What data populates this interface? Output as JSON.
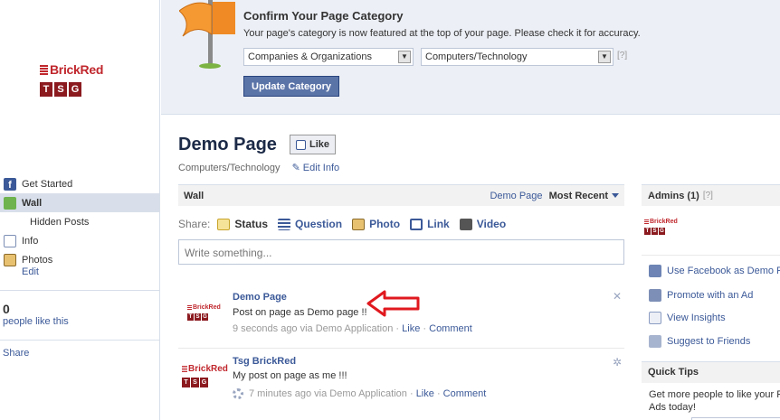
{
  "left": {
    "logo_text": "BrickRed",
    "logo_letters": [
      "T",
      "S",
      "G"
    ],
    "nav": [
      {
        "label": "Get Started",
        "icon": "facebook-icon"
      },
      {
        "label": "Wall",
        "icon": "wall-icon",
        "active": true
      },
      {
        "label": "Hidden Posts",
        "sub": true
      },
      {
        "label": "Info",
        "icon": "info-icon"
      },
      {
        "label": "Photos",
        "icon": "photos-icon"
      }
    ],
    "photos_edit": "Edit",
    "likes_count": "0",
    "likes_label": "people like this",
    "share": "Share"
  },
  "banner": {
    "title": "Confirm Your Page Category",
    "description": "Your page's category is now featured at the top of your page. Please check it for accuracy.",
    "category_select": "Companies & Organizations",
    "subcategory_select": "Computers/Technology",
    "help": "[?]",
    "update_button": "Update Category"
  },
  "page": {
    "title": "Demo Page",
    "like_button": "Like",
    "category": "Computers/Technology",
    "edit_info": "Edit Info"
  },
  "wall": {
    "label": "Wall",
    "filter_page": "Demo Page",
    "filter_sort": "Most Recent",
    "share_label": "Share:",
    "share_items": [
      "Status",
      "Question",
      "Photo",
      "Link",
      "Video"
    ],
    "composer_placeholder": "Write something...",
    "stories": [
      {
        "author": "Demo Page",
        "message": "Post on page as Demo page !!",
        "time": "9 seconds ago via Demo Application",
        "sep": "·",
        "like": "Like",
        "comment": "Comment",
        "close": "✕"
      },
      {
        "author": "Tsg BrickRed",
        "message": "My post on page as me !!!",
        "time": "7 minutes ago via Demo Application",
        "sep": "·",
        "like": "Like",
        "comment": "Comment"
      }
    ]
  },
  "right": {
    "admins_title": "Admins (1)",
    "admins_help": "[?]",
    "links": [
      {
        "label": "Use Facebook as Demo Pa",
        "icon": "facebook-icon"
      },
      {
        "label": "Promote with an Ad",
        "icon": "ad-icon"
      },
      {
        "label": "View Insights",
        "icon": "insights-icon"
      },
      {
        "label": "Suggest to Friends",
        "icon": "friends-icon"
      }
    ],
    "tips_title": "Quick Tips",
    "tips_text_1": "Get more people to like your Pa",
    "tips_text_2": "Ads today!"
  },
  "colors": {
    "link": "#3b5998",
    "banner_bg": "#eceff5",
    "button_bg": "#5b74a8",
    "brand_red": "#c0272d",
    "arrow_red": "#e0191f"
  }
}
